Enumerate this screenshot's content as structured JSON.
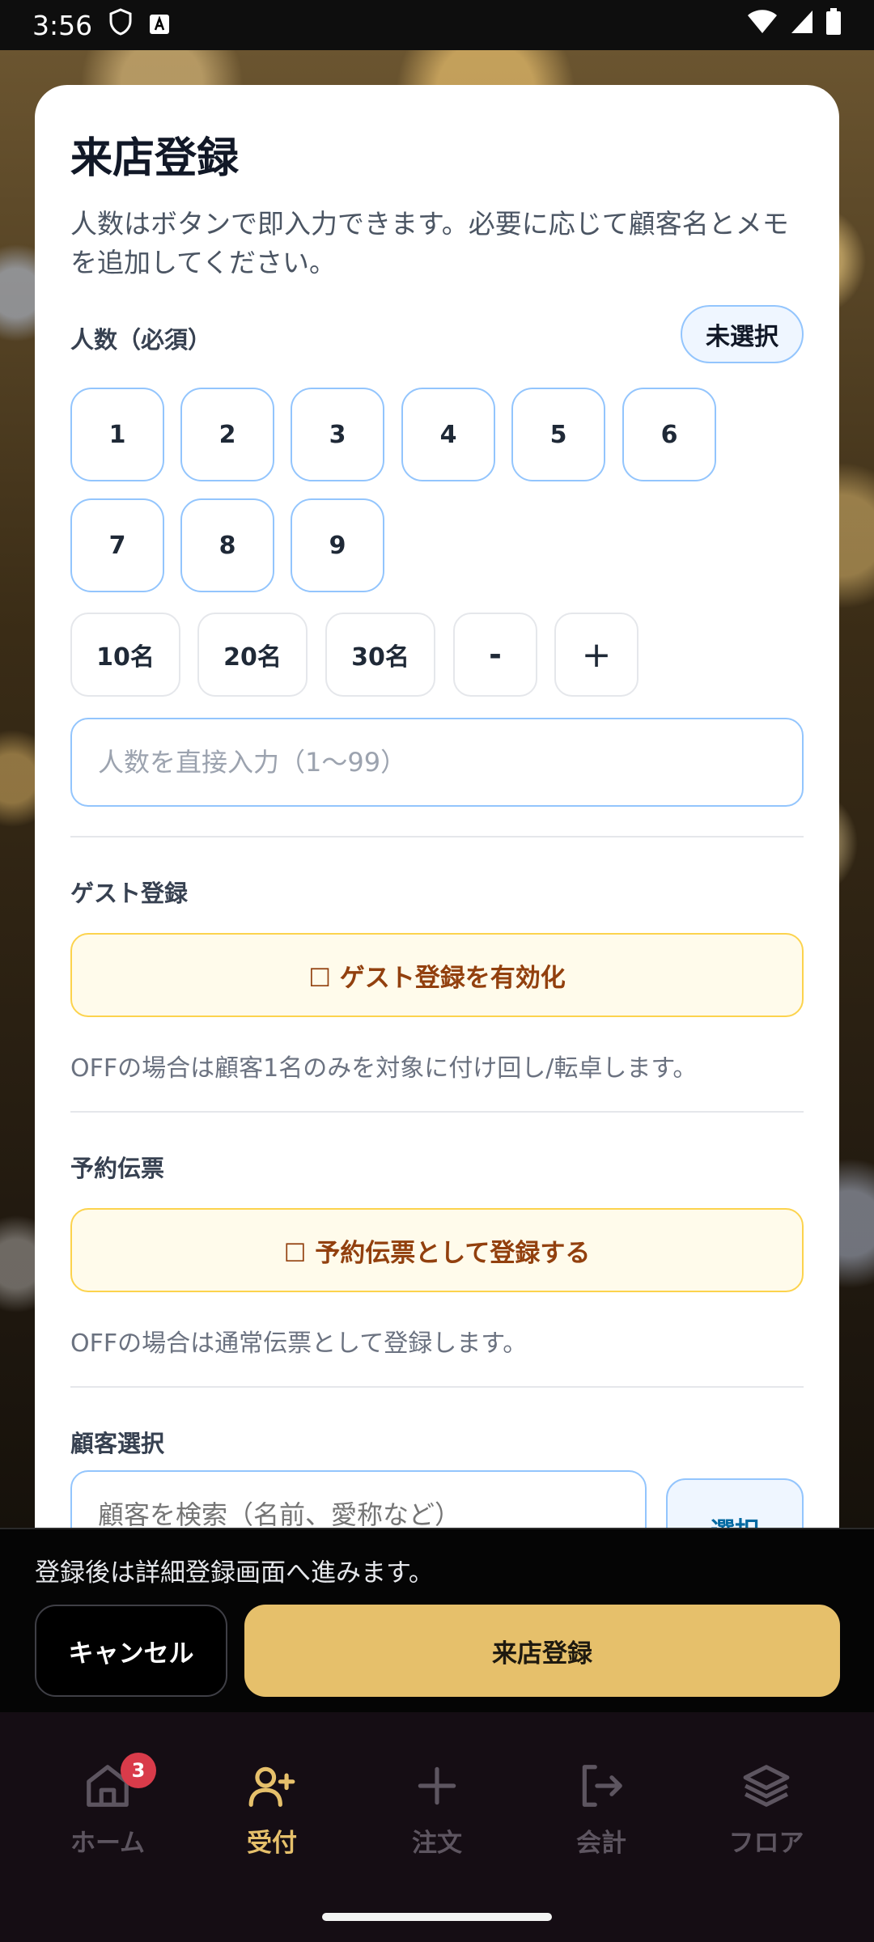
{
  "status_bar": {
    "time": "3:56"
  },
  "card": {
    "title": "来店登録",
    "description": "人数はボタンで即入力できます。必要に応じて顧客名とメモを追加してください。",
    "people": {
      "label": "人数（必須）",
      "selection_pill": "未選択",
      "numbers": [
        "1",
        "2",
        "3",
        "4",
        "5",
        "6",
        "7",
        "8",
        "9"
      ],
      "quick": [
        "10名",
        "20名",
        "30名"
      ],
      "minus": "-",
      "plus": "+",
      "input_placeholder": "人数を直接入力（1〜99）"
    },
    "guest": {
      "label": "ゲスト登録",
      "toggle": "☐ ゲスト登録を有効化",
      "note": "OFFの場合は顧客1名のみを対象に付け回し/転卓します。"
    },
    "reservation": {
      "label": "予約伝票",
      "toggle": "☐ 予約伝票として登録する",
      "note": "OFFの場合は通常伝票として登録します。"
    },
    "customer": {
      "label": "顧客選択",
      "search_placeholder": "顧客を検索（名前、愛称など）",
      "select_button": "選択"
    }
  },
  "action_panel": {
    "note": "登録後は詳細登録画面へ進みます。",
    "cancel": "キャンセル",
    "submit": "来店登録"
  },
  "bottom_nav": {
    "items": [
      {
        "label": "ホーム",
        "icon": "home-icon",
        "badge": "3"
      },
      {
        "label": "受付",
        "icon": "user-plus-icon"
      },
      {
        "label": "注文",
        "icon": "plus-icon"
      },
      {
        "label": "会計",
        "icon": "logout-icon"
      },
      {
        "label": "フロア",
        "icon": "layers-icon"
      }
    ],
    "active": "受付"
  },
  "colors": {
    "accent": "#e6c06b",
    "border_blue": "#93c5fd",
    "toggle_bg": "#fffbeb"
  }
}
